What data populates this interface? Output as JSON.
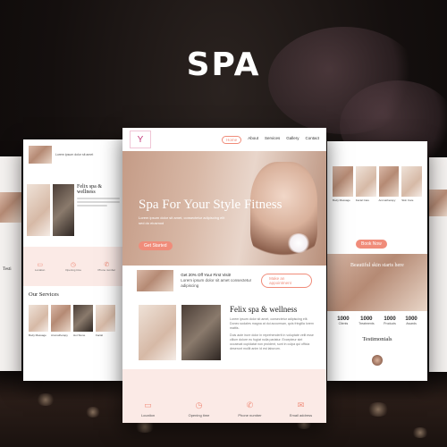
{
  "title": "SPA",
  "main": {
    "logo_glyph": "Y",
    "nav": [
      "Home",
      "About",
      "Services",
      "Gallery",
      "Contact"
    ],
    "hero_title": "Spa For Your Style Fitness",
    "hero_sub": "Lorem ipsum dolor sit amet, consectetur adipiscing elit sed do eiusmod",
    "hero_button": "Get Started",
    "offer_title": "Get 20% Off Your First Visit!",
    "offer_text": "Lorem ipsum dolor sit amet consectetur adipiscing",
    "offer_button": "Make an appointment",
    "about_title": "Felix spa & wellness",
    "about_p1": "Lorem ipsum dolor sit amet, consectetur adipiscing elit. Donec sodales magna at dui accumsan, quis fringilla lorem mattis.",
    "about_p2": "Duis aute irure dolor in reprehenderit in voluptate velit esse cillum dolore eu fugiat nulla pariatur. Excepteur sint occaecat cupidatat non proident, sunt in culpa qui officia deserunt mollit anim id est laborum.",
    "features": [
      {
        "icon": "map-icon",
        "glyph": "▭",
        "label": "Location"
      },
      {
        "icon": "clock-icon",
        "glyph": "◷",
        "label": "Opening time"
      },
      {
        "icon": "phone-icon",
        "glyph": "✆",
        "label": "Phone number"
      },
      {
        "icon": "mail-icon",
        "glyph": "✉",
        "label": "Email address"
      }
    ]
  },
  "left": {
    "header_text": "Lorem ipsum dolor sit amet",
    "about_title": "Felix spa & wellness",
    "features": [
      "Location",
      "Opening time",
      "Phone number"
    ],
    "services_title": "Our Services",
    "services": [
      "Body Massage",
      "Aromatherapy",
      "Hot Stone",
      "Facial"
    ]
  },
  "farleft": {
    "text": "Testi"
  },
  "right": {
    "services": [
      "Body Massage",
      "Facial Care",
      "Aromatherapy",
      "Skin Care"
    ],
    "book_button": "Book Now",
    "band_text": "Beautiful skin starts here",
    "stats": [
      {
        "n": "1000",
        "l": "Clients"
      },
      {
        "n": "1000",
        "l": "Treatments"
      },
      {
        "n": "1000",
        "l": "Products"
      },
      {
        "n": "1000",
        "l": "Awards"
      }
    ],
    "testimonials_title": "Testimonials"
  },
  "colors": {
    "accent": "#f08c7a",
    "pink": "#fbeae6",
    "brand": "#c43b7b"
  }
}
